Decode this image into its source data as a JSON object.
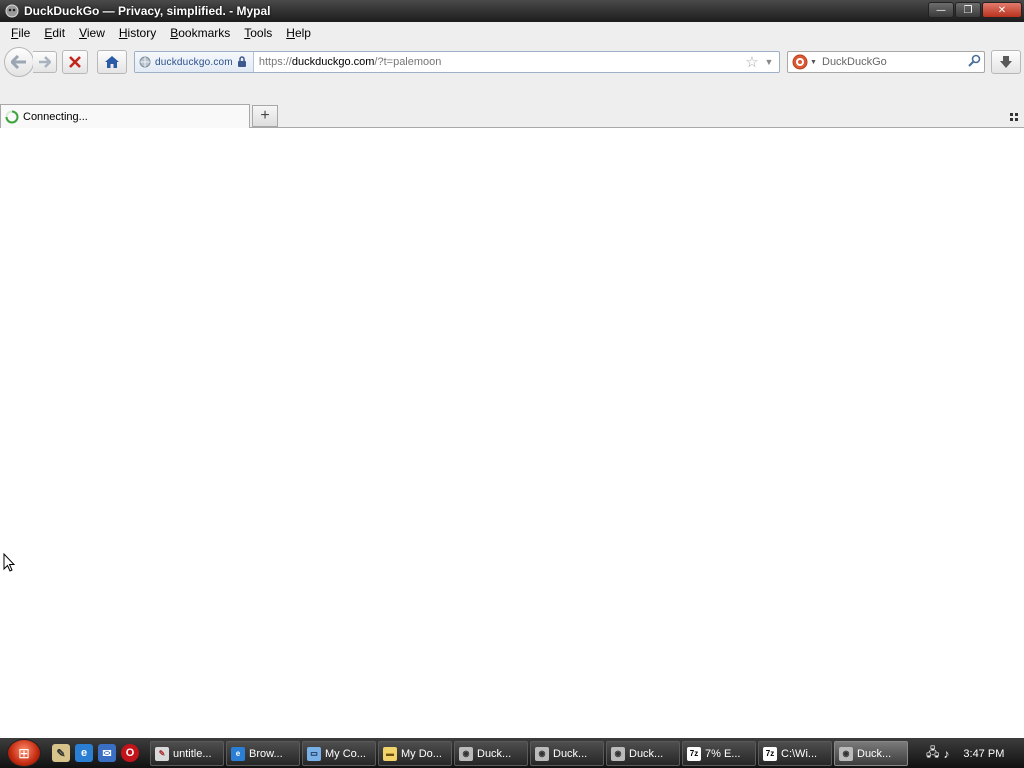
{
  "window": {
    "title": "DuckDuckGo — Privacy, simplified. - Mypal",
    "buttons": {
      "minimize": "—",
      "restore": "❐",
      "close": "✕"
    }
  },
  "menubar": {
    "items": [
      "File",
      "Edit",
      "View",
      "History",
      "Bookmarks",
      "Tools",
      "Help"
    ]
  },
  "navbar": {
    "identity_domain": "duckduckgo.com",
    "url_prefix": "https://",
    "url_host": "duckduckgo.com",
    "url_rest": "/?t=palemoon",
    "search_placeholder": "DuckDuckGo"
  },
  "tabs": {
    "active_label": "Connecting...",
    "new_tab_label": "+"
  },
  "taskbar": {
    "buttons": [
      {
        "label": "untitle...",
        "icon": "paint-icon",
        "color": "#d9d9d9"
      },
      {
        "label": "Brow...",
        "icon": "ie-icon",
        "color": "#2a7fd4"
      },
      {
        "label": "My Co...",
        "icon": "computer-icon",
        "color": "#7ab0e8"
      },
      {
        "label": "My Do...",
        "icon": "folder-icon",
        "color": "#f1d36a"
      },
      {
        "label": "Duck...",
        "icon": "mypal-icon",
        "color": "#bbbbbb"
      },
      {
        "label": "Duck...",
        "icon": "mypal-icon",
        "color": "#bbbbbb"
      },
      {
        "label": "Duck...",
        "icon": "mypal-icon",
        "color": "#bbbbbb"
      },
      {
        "label": "7% E...",
        "icon": "7zip-icon",
        "color": "#ffffff"
      },
      {
        "label": "C:\\Wi...",
        "icon": "7zip-icon",
        "color": "#ffffff"
      },
      {
        "label": "Duck...",
        "icon": "mypal-icon",
        "color": "#bbbbbb",
        "active": true
      }
    ],
    "clock": "3:47 PM"
  }
}
